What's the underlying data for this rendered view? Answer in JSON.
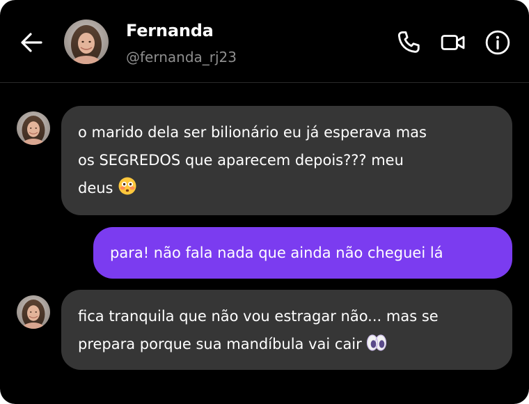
{
  "contact": {
    "name": "Fernanda",
    "handle": "@fernanda_rj23"
  },
  "icons": {
    "back": "arrow-left-icon",
    "call": "phone-icon",
    "video": "video-camera-icon",
    "info": "info-icon"
  },
  "colors": {
    "background": "#000000",
    "incoming_bubble": "#363636",
    "outgoing_bubble": "#7b3cf0",
    "handle_text": "#8e8e8e"
  },
  "messages": [
    {
      "direction": "incoming",
      "lines": [
        "o marido dela ser bilionário eu já esperava mas",
        "os SEGREDOS que aparecem depois??? meu",
        "deus"
      ],
      "emoji": "flushed-face-emoji"
    },
    {
      "direction": "outgoing",
      "lines": [
        "para! não fala nada que ainda não cheguei lá"
      ]
    },
    {
      "direction": "incoming",
      "lines": [
        "fica tranquila que não vou estragar não... mas se",
        "prepara porque sua mandíbula vai cair"
      ],
      "emoji": "eyes-emoji"
    }
  ]
}
